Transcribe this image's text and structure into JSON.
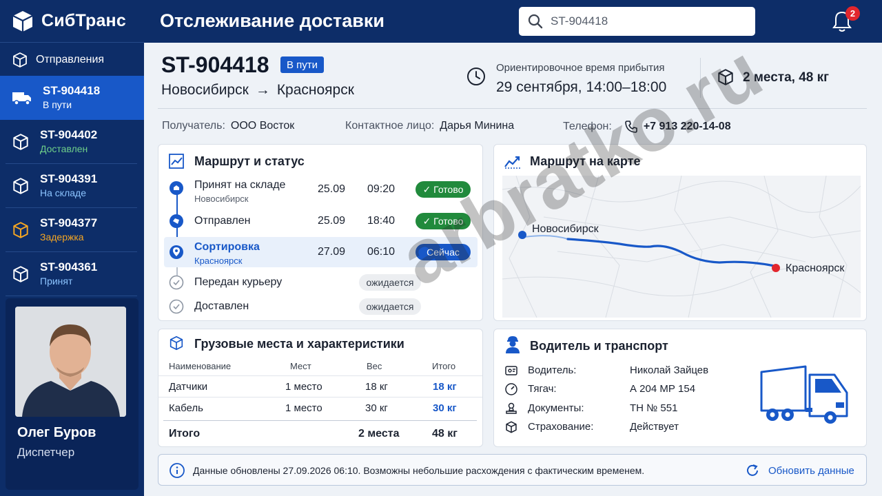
{
  "app": {
    "brand": "СибТранс",
    "page_title": "Отслеживание доставки"
  },
  "search": {
    "value": "ST-904418"
  },
  "notifications": {
    "count": "2"
  },
  "sidebar": {
    "section_label": "Отправления",
    "items": [
      {
        "number": "ST-904418",
        "status": "В пути",
        "status_color": "#ffffff",
        "icon": "truck-icon",
        "active": true
      },
      {
        "number": "ST-904402",
        "status": "Доставлен",
        "status_color": "#6fd08a",
        "icon": "box-icon"
      },
      {
        "number": "ST-904391",
        "status": "На складе",
        "status_color": "#8cc4ff",
        "icon": "box-icon"
      },
      {
        "number": "ST-904377",
        "status": "Задержка",
        "status_color": "#f5a623",
        "icon": "box-icon-warning"
      },
      {
        "number": "ST-904361",
        "status": "Принят",
        "status_color": "#8cc4ff",
        "icon": "box-icon"
      }
    ]
  },
  "profile": {
    "name": "Олег Буров",
    "role": "Диспетчер"
  },
  "shipment": {
    "id": "ST-904418",
    "status": "В пути",
    "origin": "Новосибирск",
    "arrow": "→",
    "destination": "Красноярск",
    "eta_label": "Ориентировочное время прибытия",
    "eta_value": "29 сентября, 14:00–18:00",
    "packages": "2 места, 48 кг"
  },
  "contacts": {
    "recipient_label": "Получатель:",
    "recipient": "ООО Восток",
    "person_label": "Контактное лицо:",
    "person": "Дарья Минина",
    "phone_label": "Телефон:",
    "phone": "+7 913 220-14-08"
  },
  "route_card": {
    "title": "Маршрут и статус",
    "steps": [
      {
        "name": "Принят на складе",
        "sub": "Новосибирск",
        "date": "25.09",
        "time": "09:20",
        "badge": "✓ Готово",
        "state": "done"
      },
      {
        "name": "Отправлен",
        "sub": "",
        "date": "25.09",
        "time": "18:40",
        "badge": "✓ Готово",
        "state": "done"
      },
      {
        "name": "Сортировка",
        "sub": "Красноярск",
        "date": "27.09",
        "time": "06:10",
        "badge": "Сейчас",
        "state": "current"
      },
      {
        "name": "Передан курьеру",
        "sub": "",
        "date": "",
        "time": "",
        "badge": "ожидается",
        "state": "pending"
      },
      {
        "name": "Доставлен",
        "sub": "",
        "date": "",
        "time": "",
        "badge": "ожидается",
        "state": "pending"
      }
    ]
  },
  "map_card": {
    "title": "Маршрут на карте",
    "from_city": "Новосибирск",
    "to_city": "Красноярск"
  },
  "cargo_card": {
    "title": "Грузовые места и характеристики",
    "columns": [
      "Наименование",
      "Мест",
      "Вес",
      "Итого"
    ],
    "rows": [
      {
        "name": "Датчики",
        "places": "1 место",
        "weight": "18 кг",
        "total": "18 кг"
      },
      {
        "name": "Кабель",
        "places": "1 место",
        "weight": "30 кг",
        "total": "30 кг"
      }
    ],
    "summary": {
      "label": "Итого",
      "places": "2 места",
      "total": "48 кг"
    }
  },
  "driver_card": {
    "title": "Водитель и транспорт",
    "rows": [
      {
        "label": "Водитель:",
        "value": "Николай Зайцев",
        "icon": "id-card-icon"
      },
      {
        "label": "Тягач:",
        "value": "А 204 МР 154",
        "icon": "gauge-icon"
      },
      {
        "label": "Документы:",
        "value": "ТН № 551",
        "icon": "stamp-icon"
      },
      {
        "label": "Страхование:",
        "value": "Действует",
        "icon": "box-icon"
      }
    ]
  },
  "footer": {
    "message": "Данные обновлены 27.09.2026 06:10. Возможны небольшие расхождения с фактическим временем.",
    "refresh_label": "Обновить данные"
  },
  "watermark": "arbratko.ru",
  "colors": {
    "navy": "#0d2d68",
    "accent": "#1858c8",
    "success": "#218a3c",
    "danger": "#e2262d"
  }
}
